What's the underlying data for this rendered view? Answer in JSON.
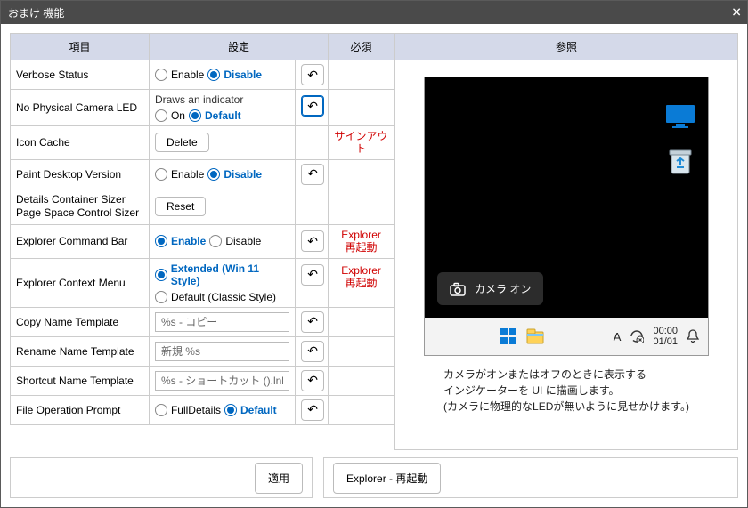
{
  "window": {
    "title": "おまけ 機能"
  },
  "headers": {
    "item": "項目",
    "setting": "設定",
    "required": "必須",
    "reference": "参照"
  },
  "labels": {
    "enable": "Enable",
    "disable": "Disable",
    "on": "On",
    "default": "Default",
    "extended": "Extended (Win 11 Style)",
    "classic": "Default (Classic Style)",
    "fulldetails": "FullDetails",
    "delete": "Delete",
    "reset": "Reset",
    "apply": "適用",
    "explorer_restart_btn": "Explorer - 再起動"
  },
  "rows": {
    "verbose_status": {
      "label": "Verbose Status"
    },
    "no_phys_led": {
      "label": "No Physical Camera LED",
      "desc": "Draws an indicator"
    },
    "icon_cache": {
      "label": "Icon Cache",
      "req": "サインアウト"
    },
    "paint_desktop": {
      "label": "Paint Desktop Version"
    },
    "details_sizer": {
      "label1": "Details Container Sizer",
      "label2": "Page Space Control Sizer"
    },
    "cmd_bar": {
      "label": "Explorer Command Bar",
      "req1": "Explorer",
      "req2": "再起動"
    },
    "context_menu": {
      "label": "Explorer Context Menu",
      "req1": "Explorer",
      "req2": "再起動"
    },
    "copy_name": {
      "label": "Copy Name Template",
      "value": "%s - コピー"
    },
    "rename": {
      "label": "Rename Name Template",
      "value": "新規 %s"
    },
    "shortcut": {
      "label": "Shortcut Name Template",
      "value": "%s - ショートカット ().lnk"
    },
    "file_op": {
      "label": "File Operation Prompt"
    }
  },
  "preview": {
    "toast_label": "カメラ オン",
    "ime": "A",
    "clock": {
      "time": "00:00",
      "date": "01/01"
    },
    "caption1": "カメラがオンまたはオフのときに表示する",
    "caption2": "インジケーターを UI に描画します。",
    "caption3": "(カメラに物理的なLEDが無いように見せかけます。)"
  }
}
